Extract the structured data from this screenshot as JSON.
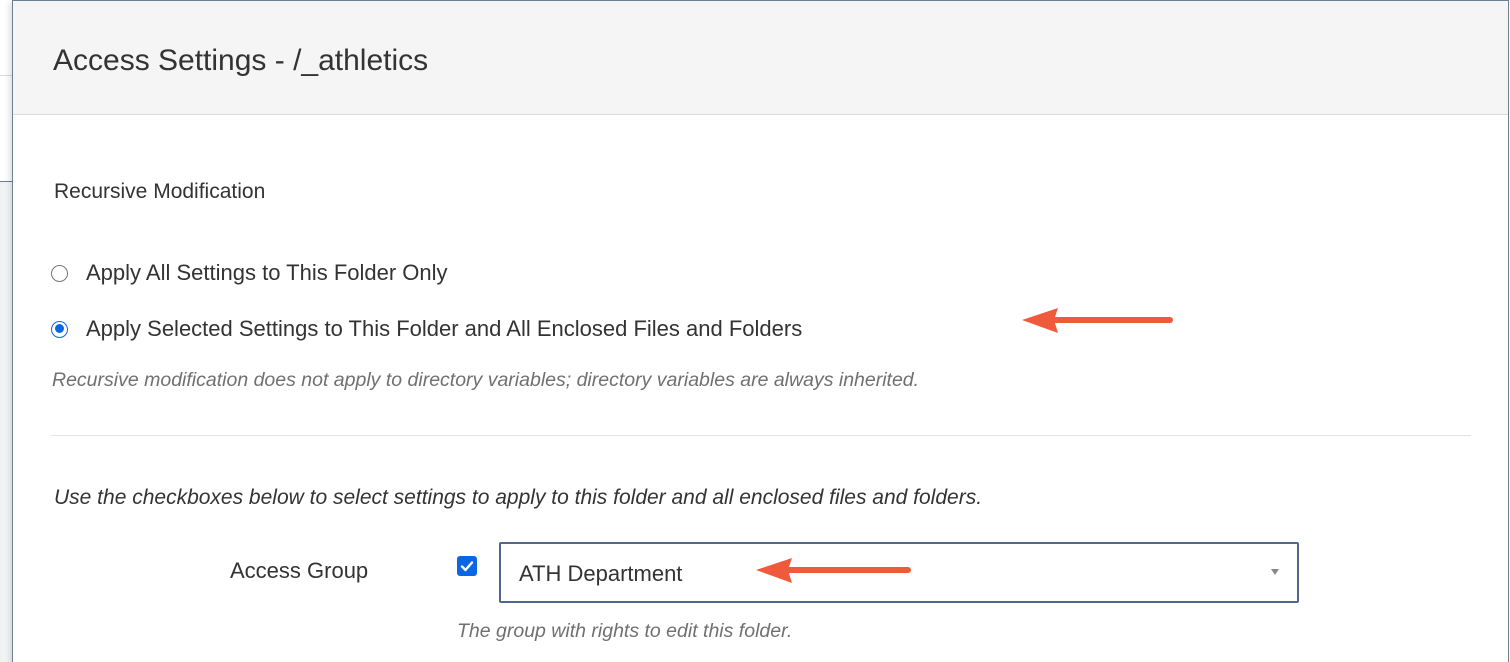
{
  "dialog": {
    "title": "Access Settings - /_athletics"
  },
  "recursive": {
    "section_label": "Recursive Modification",
    "options": [
      {
        "label": "Apply All Settings to This Folder Only",
        "checked": false
      },
      {
        "label": "Apply Selected Settings to This Folder and All Enclosed Files and Folders",
        "checked": true
      }
    ],
    "note": "Recursive modification does not apply to directory variables; directory variables are always inherited."
  },
  "settings": {
    "instruction": "Use the checkboxes below to select settings to apply to this folder and all enclosed files and folders.",
    "access_group": {
      "label": "Access Group",
      "checked": true,
      "value": "ATH Department",
      "help": "The group with rights to edit this folder."
    }
  },
  "annotations": {
    "arrow_color": "#f05a3c"
  },
  "colors": {
    "accent": "#0a66e4",
    "select_border": "#50688c",
    "header_bg": "#f5f5f5"
  }
}
